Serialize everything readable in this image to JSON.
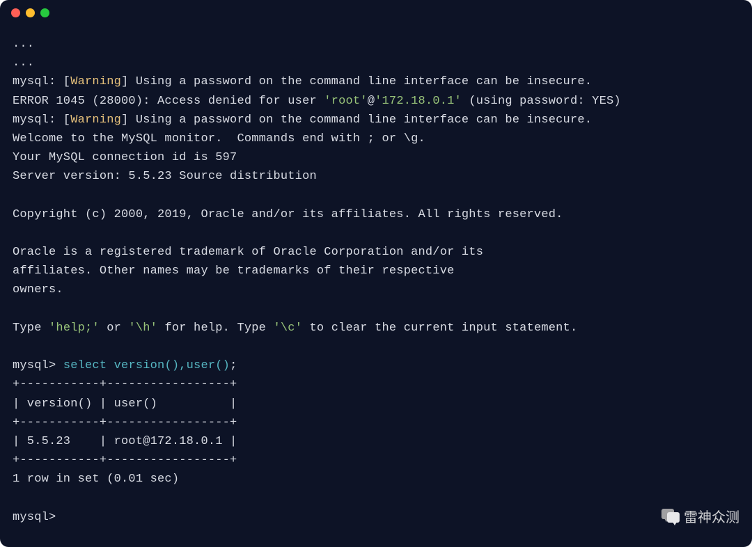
{
  "terminal": {
    "ellipsis1": "...",
    "ellipsis2": "...",
    "line_warning1_prefix": "mysql: [",
    "line_warning1_word": "Warning",
    "line_warning1_suffix": "] Using a password on the command line interface can be insecure.",
    "error_prefix": "ERROR 1045 (28000): Access denied for user ",
    "error_user": "'root'",
    "error_at": "@",
    "error_host": "'172.18.0.1'",
    "error_suffix": " (using password: YES)",
    "line_warning2_prefix": "mysql: [",
    "line_warning2_word": "Warning",
    "line_warning2_suffix": "] Using a password on the command line interface can be insecure.",
    "welcome": "Welcome to the MySQL monitor.  Commands end with ; or \\g.",
    "conn_id": "Your MySQL connection id is 597",
    "server_version": "Server version: 5.5.23 Source distribution",
    "copyright": "Copyright (c) 2000, 2019, Oracle and/or its affiliates. All rights reserved.",
    "trademark1": "Oracle is a registered trademark of Oracle Corporation and/or its",
    "trademark2": "affiliates. Other names may be trademarks of their respective",
    "trademark3": "owners.",
    "help_prefix": "Type ",
    "help_cmd1": "'help;'",
    "help_or": " or ",
    "help_cmd2": "'\\h'",
    "help_mid": " for help. Type ",
    "help_cmd3": "'\\c'",
    "help_suffix": " to clear the current input statement.",
    "prompt1": "mysql> ",
    "query_select": "select",
    "query_space1": " ",
    "query_func": "version(),user()",
    "query_semicolon": ";",
    "table_border": "+-----------+-----------------+",
    "table_header": "| version() | user()          |",
    "table_row": "| 5.5.23    | root@172.18.0.1 |",
    "result_summary": "1 row in set (0.01 sec)",
    "prompt2": "mysql>",
    "watermark_text": "雷神众测"
  }
}
